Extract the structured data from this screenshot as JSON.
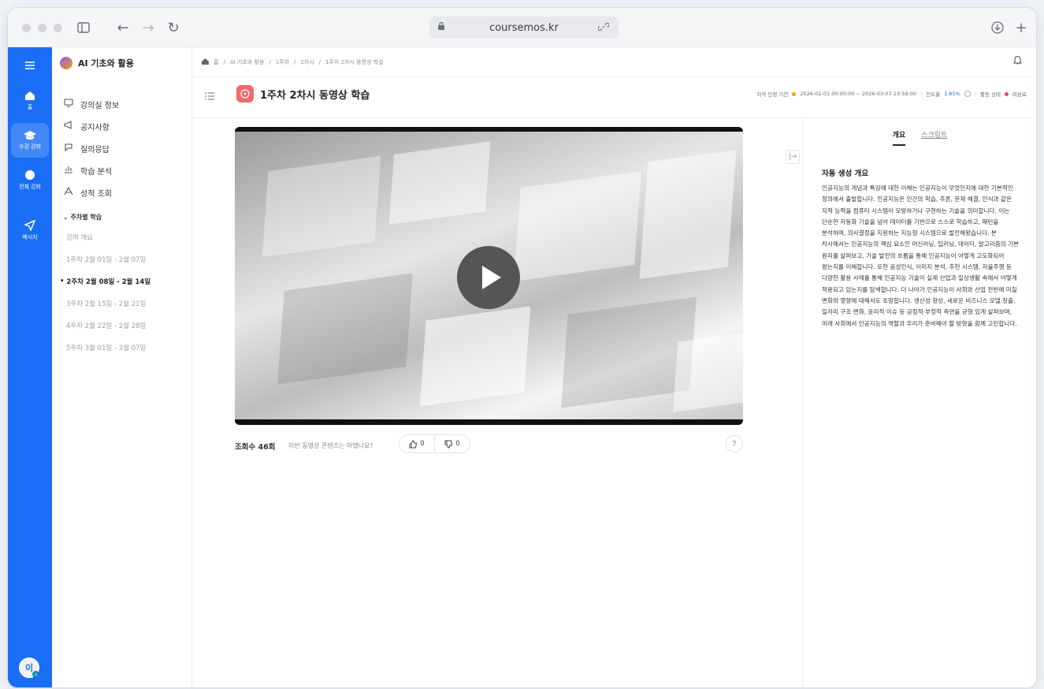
{
  "browser": {
    "url": "coursemos.kr"
  },
  "rail": {
    "items": [
      {
        "label": "홈"
      },
      {
        "label": "수강 강좌"
      },
      {
        "label": "전체 강좌"
      },
      {
        "label": "메시지"
      }
    ],
    "avatar_initial": "이"
  },
  "course": {
    "title": "AI 기초와 활용",
    "menu": [
      {
        "label": "강의실 정보",
        "icon": "monitor-icon"
      },
      {
        "label": "공지사항",
        "icon": "megaphone-icon"
      },
      {
        "label": "질의응답",
        "icon": "chat-icon"
      },
      {
        "label": "학습 분석",
        "icon": "chart-icon"
      },
      {
        "label": "성적 조회",
        "icon": "grade-icon"
      }
    ],
    "weekly_header": "주차별 학습",
    "weeks": [
      {
        "label": "강의 개요"
      },
      {
        "label": "1주차 2월 01일 - 2월 07일"
      },
      {
        "label": "2주차 2월 08일 - 2월 14일"
      },
      {
        "label": "3주차 2월 15일 - 2월 21일"
      },
      {
        "label": "4주차 2월 22일 - 2월 28일"
      },
      {
        "label": "5주차 3월 01일 - 3월 07일"
      }
    ]
  },
  "breadcrumb": {
    "items": [
      "홈",
      "AI 기초와 활용",
      "1주차",
      "2차시",
      "1주차 2차시 동영상 학습"
    ]
  },
  "header": {
    "title": "1주차 2차시 동영상 학습",
    "period_label": "지각 인정 기간",
    "period": "2026-02-01 00:00:00 ~ 2026-03-07 23:59:00",
    "progress_label": "진도율",
    "progress": "1.85%",
    "status_label": "활동 상태",
    "status": "미완료"
  },
  "video_meta": {
    "views_label": "조회수 46회",
    "question": "이번 동영상 콘텐츠는 어땠나요?",
    "likes": "0",
    "dislikes": "0"
  },
  "panel": {
    "tab_overview": "개요",
    "tab_script": "스크립트",
    "summary_title": "자동 생성 개요",
    "summary_text": "인공지능의 개념과 특징에 대한 이해는 인공지능이 무엇인지에 대한 기본적인 정의에서 출발합니다. 인공지능은 인간의 학습, 추론, 문제 해결, 인식과 같은 지적 능력을 컴퓨터 시스템이 모방하거나 구현하는 기술을 의미합니다. 이는 단순한 자동화 기술을 넘어 데이터를 기반으로 스스로 학습하고, 패턴을 분석하며, 의사결정을 지원하는 지능형 시스템으로 발전해왔습니다. 본 차시에서는 인공지능의 핵심 요소인 머신러닝, 딥러닝, 데이터, 알고리즘의 기본 원리를 살펴보고, 기술 발전의 흐름을 통해 인공지능이 어떻게 고도화되어 왔는지를 이해합니다. 또한 음성인식, 이미지 분석, 추천 시스템, 자율주행 등 다양한 활용 사례를 통해 인공지능 기술이 실제 산업과 일상생활 속에서 어떻게 적용되고 있는지를 탐색합니다. 더 나아가 인공지능이 사회와 산업 전반에 미칠 변화와 영향에 대해서도 조망합니다. 생산성 향상, 새로운 비즈니스 모델 창출, 일자리 구조 변화, 윤리적 이슈 등 긍정적·부정적 측면을 균형 있게 살펴보며, 미래 사회에서 인공지능의 역할과 우리가 준비해야 할 방향을 함께 고민합니다."
  }
}
